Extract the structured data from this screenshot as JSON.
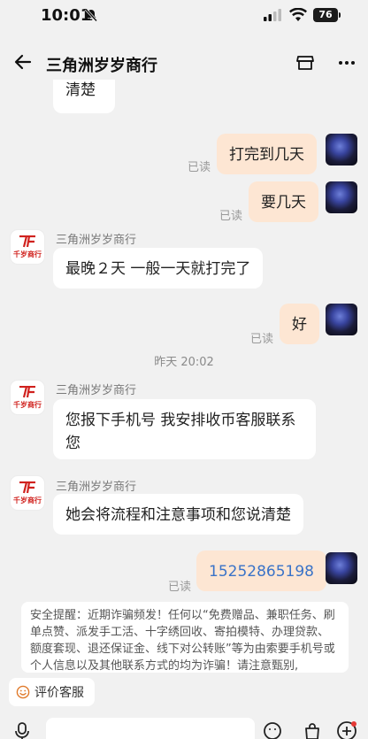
{
  "status": {
    "time": "10:01",
    "battery": "76"
  },
  "header": {
    "title": "三角洲岁岁商行"
  },
  "chat": {
    "top_partial": "清楚",
    "m1": {
      "text": "打完到几天",
      "read": "已读"
    },
    "m2": {
      "text": "要几天",
      "read": "已读"
    },
    "shop_name": "三角洲岁岁商行",
    "shop_logo_text": "千岁商行",
    "r1": {
      "text": "最晚２天 一般一天就打完了"
    },
    "m3": {
      "text": "好",
      "read": "已读"
    },
    "timestamp": "昨天 20:02",
    "r2": {
      "line1": "您报下手机号 我安排收币客服联系",
      "line2": "您"
    },
    "r3": {
      "text": "她会将流程和注意事项和您说清楚"
    },
    "m4": {
      "text": "15252865198",
      "read": "已读"
    }
  },
  "warning": {
    "text": "安全提醒：近期诈骗频发！任何以“免费赠品、兼职任务、刷单点赞、派发手工活、十字绣回收、寄拍模特、办理贷款、额度套现、退还保证金、线下对公转账”等为由索要手机号或个人信息以及其他联系方式的均为诈骗！请注意甄别,"
  },
  "bottom": {
    "rate_label": "评价客服"
  },
  "colors": {
    "outgoing_bubble": "#fde6d3",
    "phone_link": "#3a73c8",
    "brand_red": "#d0211d"
  },
  "icons": [
    "bell-off-icon",
    "signal-icon",
    "wifi-icon",
    "battery-icon",
    "back-arrow-icon",
    "shop-icon",
    "more-icon",
    "smile-icon",
    "mic-icon",
    "emoji-icon",
    "bag-icon",
    "plus-icon"
  ]
}
